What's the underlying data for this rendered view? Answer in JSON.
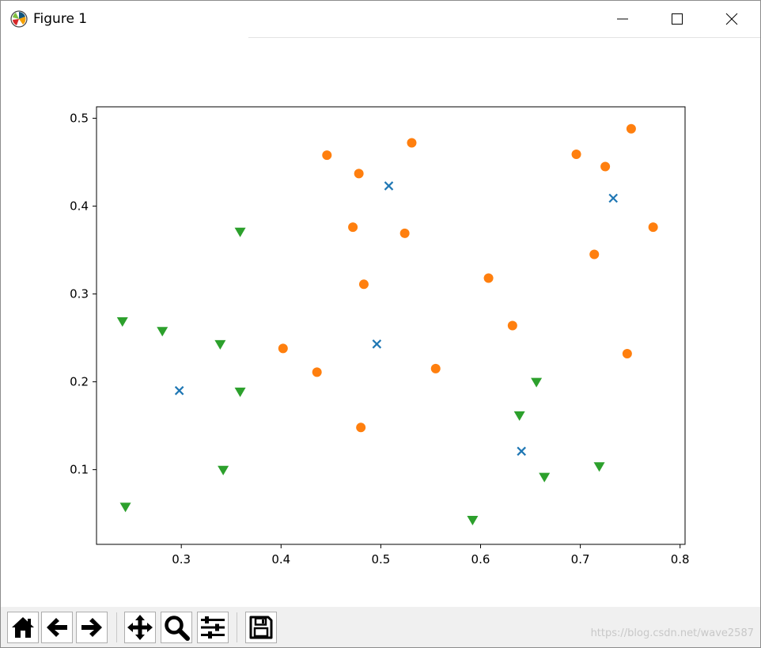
{
  "window": {
    "title": "Figure 1",
    "app_icon": "matplotlib-icon",
    "controls": {
      "minimize": "minimize-icon",
      "maximize": "maximize-icon",
      "close": "close-icon"
    }
  },
  "toolbar": {
    "buttons": [
      {
        "name": "home-button",
        "icon": "home-icon"
      },
      {
        "name": "back-button",
        "icon": "arrow-left-icon"
      },
      {
        "name": "forward-button",
        "icon": "arrow-right-icon"
      },
      {
        "name": "pan-button",
        "icon": "move-icon"
      },
      {
        "name": "zoom-button",
        "icon": "magnifier-icon"
      },
      {
        "name": "configure-subplots-button",
        "icon": "sliders-icon"
      },
      {
        "name": "save-button",
        "icon": "floppy-disk-icon"
      }
    ],
    "watermark": "https://blog.csdn.net/wave2587"
  },
  "chart_data": {
    "type": "scatter",
    "title": "",
    "xlabel": "",
    "ylabel": "",
    "xlim": [
      0.215,
      0.805
    ],
    "ylim": [
      0.015,
      0.513
    ],
    "xticks": [
      0.3,
      0.4,
      0.5,
      0.6,
      0.7,
      0.8
    ],
    "xtick_labels": [
      "0.3",
      "0.4",
      "0.5",
      "0.6",
      "0.7",
      "0.8"
    ],
    "yticks": [
      0.1,
      0.2,
      0.3,
      0.4,
      0.5
    ],
    "ytick_labels": [
      "0.1",
      "0.2",
      "0.3",
      "0.4",
      "0.5"
    ],
    "grid": false,
    "series": [
      {
        "marker": "x",
        "color": "#1f77b4",
        "points": [
          [
            0.298,
            0.19
          ],
          [
            0.508,
            0.423
          ],
          [
            0.496,
            0.243
          ],
          [
            0.641,
            0.121
          ],
          [
            0.733,
            0.409
          ]
        ]
      },
      {
        "marker": "circle",
        "color": "#ff7f0e",
        "points": [
          [
            0.446,
            0.458
          ],
          [
            0.478,
            0.437
          ],
          [
            0.531,
            0.472
          ],
          [
            0.472,
            0.376
          ],
          [
            0.524,
            0.369
          ],
          [
            0.483,
            0.311
          ],
          [
            0.402,
            0.238
          ],
          [
            0.436,
            0.211
          ],
          [
            0.48,
            0.148
          ],
          [
            0.555,
            0.215
          ],
          [
            0.608,
            0.318
          ],
          [
            0.632,
            0.264
          ],
          [
            0.696,
            0.459
          ],
          [
            0.725,
            0.445
          ],
          [
            0.751,
            0.488
          ],
          [
            0.714,
            0.345
          ],
          [
            0.773,
            0.376
          ],
          [
            0.747,
            0.232
          ]
        ]
      },
      {
        "marker": "triangle-down",
        "color": "#2ca02c",
        "points": [
          [
            0.241,
            0.268
          ],
          [
            0.281,
            0.257
          ],
          [
            0.339,
            0.242
          ],
          [
            0.359,
            0.37
          ],
          [
            0.359,
            0.188
          ],
          [
            0.342,
            0.099
          ],
          [
            0.244,
            0.057
          ],
          [
            0.592,
            0.042
          ],
          [
            0.639,
            0.161
          ],
          [
            0.656,
            0.199
          ],
          [
            0.664,
            0.091
          ],
          [
            0.719,
            0.103
          ]
        ]
      }
    ]
  }
}
